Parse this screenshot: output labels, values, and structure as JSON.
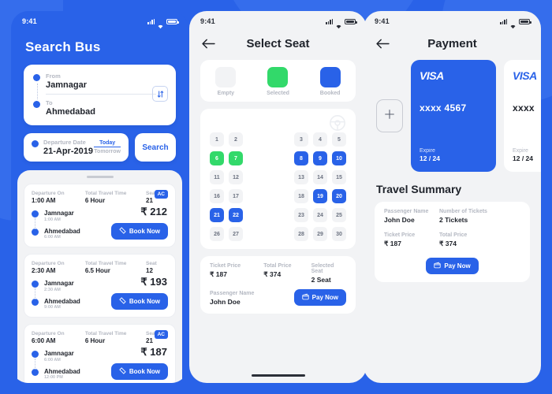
{
  "statusbar": {
    "time": "9:41",
    "icons": [
      "signal-icon",
      "wifi-icon",
      "battery-icon"
    ]
  },
  "colors": {
    "brand_blue": "#2962E8",
    "selected_green": "#32D96A",
    "empty_gray": "#F2F3F5",
    "screen_bg": "#F2F3F5"
  },
  "screen1": {
    "title": "Search Bus",
    "route": {
      "from_label": "From",
      "from_value": "Jamnagar",
      "to_label": "To",
      "to_value": "Ahmedabad",
      "swap_icon": "swap-vertical-icon"
    },
    "departure": {
      "label": "Departure Date",
      "value": "21-Apr-2019",
      "today": "Today",
      "tomorrow": "Tomorrow"
    },
    "search_button": "Search",
    "columns": {
      "departure": "Departure On",
      "travel_time": "Total Travel Time",
      "seat": "Seat"
    },
    "ac_badge": "AC",
    "book_button": "Book Now",
    "buses": [
      {
        "departure": "1:00 AM",
        "travel_time": "6 Hour",
        "seat": "21",
        "price": "₹ 212",
        "ac": true,
        "from_city": "Jamnagar",
        "from_time": "1:00 AM",
        "to_city": "Ahmedabad",
        "to_time": "6:00 AM"
      },
      {
        "departure": "2:30 AM",
        "travel_time": "6.5 Hour",
        "seat": "12",
        "price": "₹ 193",
        "ac": false,
        "from_city": "Jamnagar",
        "from_time": "2:30 AM",
        "to_city": "Ahmedabad",
        "to_time": "9:00 AM"
      },
      {
        "departure": "6:00 AM",
        "travel_time": "6 Hour",
        "seat": "21",
        "price": "₹ 187",
        "ac": true,
        "from_city": "Jamnagar",
        "from_time": "6:00 AM",
        "to_city": "Ahmedabad",
        "to_time": "12:00 PM"
      }
    ]
  },
  "screen2": {
    "title": "Select Seat",
    "back_icon": "arrow-left-icon",
    "legend": [
      {
        "label": "Empty",
        "state": "empty"
      },
      {
        "label": "Selected",
        "state": "sel"
      },
      {
        "label": "Booked",
        "state": "booked"
      }
    ],
    "wheel_icon": "steering-wheel-icon",
    "seat_rows": [
      {
        "left": [
          {
            "n": "1",
            "s": "empty"
          },
          {
            "n": "2",
            "s": "empty"
          }
        ],
        "right": [
          {
            "n": "3",
            "s": "empty"
          },
          {
            "n": "4",
            "s": "empty"
          },
          {
            "n": "5",
            "s": "empty"
          }
        ]
      },
      {
        "left": [
          {
            "n": "6",
            "s": "sel"
          },
          {
            "n": "7",
            "s": "sel"
          }
        ],
        "right": [
          {
            "n": "8",
            "s": "booked"
          },
          {
            "n": "9",
            "s": "booked"
          },
          {
            "n": "10",
            "s": "booked"
          }
        ]
      },
      {
        "left": [
          {
            "n": "11",
            "s": "empty"
          },
          {
            "n": "12",
            "s": "empty"
          }
        ],
        "right": [
          {
            "n": "13",
            "s": "empty"
          },
          {
            "n": "14",
            "s": "empty"
          },
          {
            "n": "15",
            "s": "empty"
          }
        ]
      },
      {
        "left": [
          {
            "n": "16",
            "s": "empty"
          },
          {
            "n": "17",
            "s": "empty"
          }
        ],
        "right": [
          {
            "n": "18",
            "s": "empty"
          },
          {
            "n": "19",
            "s": "booked"
          },
          {
            "n": "20",
            "s": "booked"
          }
        ]
      },
      {
        "left": [
          {
            "n": "21",
            "s": "booked"
          },
          {
            "n": "22",
            "s": "booked"
          }
        ],
        "right": [
          {
            "n": "23",
            "s": "empty"
          },
          {
            "n": "24",
            "s": "empty"
          },
          {
            "n": "25",
            "s": "empty"
          }
        ]
      },
      {
        "left": [
          {
            "n": "26",
            "s": "empty"
          },
          {
            "n": "27",
            "s": "empty"
          }
        ],
        "right": [
          {
            "n": "28",
            "s": "empty"
          },
          {
            "n": "29",
            "s": "empty"
          },
          {
            "n": "30",
            "s": "empty"
          }
        ]
      }
    ],
    "summary": {
      "ticket_price_label": "Ticket Price",
      "ticket_price_value": "₹ 187",
      "total_price_label": "Total Price",
      "total_price_value": "₹ 374",
      "selected_seat_label": "Selected Seat",
      "selected_seat_value": "2 Seat",
      "passenger_label": "Passenger Name",
      "passenger_value": "John Doe",
      "pay_button": "Pay Now",
      "pay_icon": "wallet-icon"
    }
  },
  "screen3": {
    "title": "Payment",
    "back_icon": "arrow-left-icon",
    "add_card_icon": "plus-icon",
    "cards": [
      {
        "brand": "VISA",
        "number": "xxxx 4567",
        "expire_label": "Expire",
        "expire_value": "12 / 24",
        "style": "blue"
      },
      {
        "brand": "VISA",
        "number": "xxxx",
        "expire_label": "Expire",
        "expire_value": "12 / 24",
        "style": "white"
      }
    ],
    "summary_title": "Travel Summary",
    "summary": {
      "passenger_label": "Passenger Name",
      "passenger_value": "John Doe",
      "tickets_label": "Number of Tickets",
      "tickets_value": "2 Tickets",
      "ticket_price_label": "Ticket Price",
      "ticket_price_value": "₹ 187",
      "total_price_label": "Total Price",
      "total_price_value": "₹ 374",
      "pay_button": "Pay Now",
      "pay_icon": "wallet-icon"
    }
  }
}
